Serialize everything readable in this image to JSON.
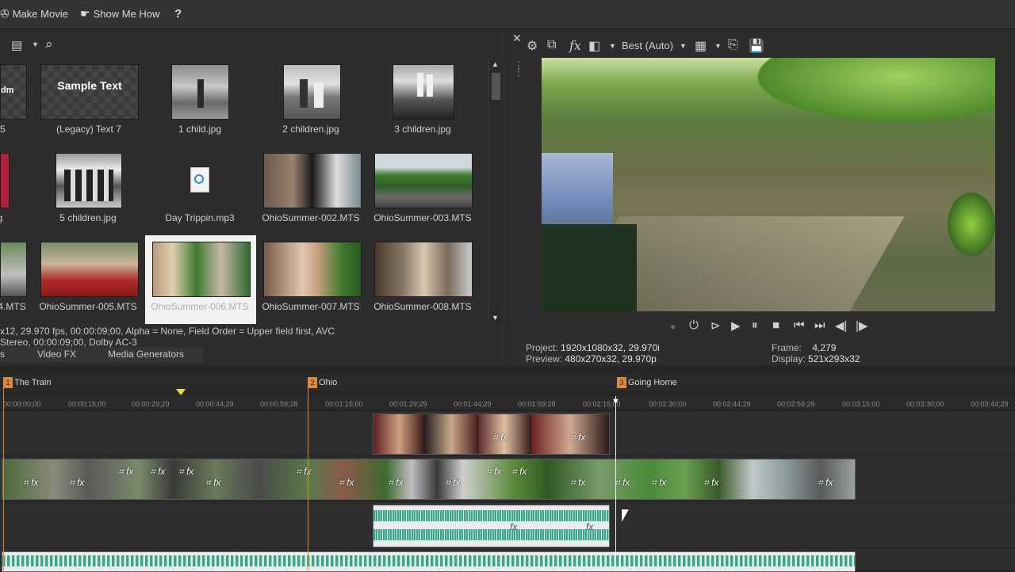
{
  "menubar": {
    "make_movie": "Make Movie",
    "show_me_how": "Show Me How",
    "help": "?"
  },
  "media": {
    "items": [
      {
        "label": "t 5",
        "kind": "checker-partial",
        "thumb_text": "dm"
      },
      {
        "label": "(Legacy) Text 7",
        "kind": "checker",
        "thumb_text": "Sample Text"
      },
      {
        "label": "1 child.jpg",
        "kind": "photo-bw"
      },
      {
        "label": "2 children.jpg",
        "kind": "photo-bw"
      },
      {
        "label": "3 children.jpg",
        "kind": "photo-bw"
      },
      {
        "label": "g",
        "kind": "photo-partial"
      },
      {
        "label": "5 children.jpg",
        "kind": "photo-bw"
      },
      {
        "label": "Day Trippin.mp3",
        "kind": "audio-file"
      },
      {
        "label": "OhioSummer-002.MTS",
        "kind": "video"
      },
      {
        "label": "OhioSummer-003.MTS",
        "kind": "video"
      },
      {
        "label": "4.MTS",
        "kind": "video-partial"
      },
      {
        "label": "OhioSummer-005.MTS",
        "kind": "video"
      },
      {
        "label": "OhioSummer-006.MTS",
        "kind": "video-selected"
      },
      {
        "label": "OhioSummer-007.MTS",
        "kind": "video"
      },
      {
        "label": "OhioSummer-008.MTS",
        "kind": "video"
      }
    ],
    "info_line1": "x12, 29.970 fps, 00:00:09;00, Alpha = None, Field Order = Upper field first, AVC",
    "info_line2": "Stereo, 00:00:09;00, Dolby AC-3",
    "tabs": [
      "s",
      "Video FX",
      "Media Generators"
    ]
  },
  "preview": {
    "quality": "Best (Auto)",
    "project_label": "Project:",
    "project_value": "1920x1080x32, 29.970i",
    "preview_label": "Preview:",
    "preview_value": "480x270x32, 29.970p",
    "frame_label": "Frame:",
    "frame_value": "4,279",
    "display_label": "Display:",
    "display_value": "521x293x32"
  },
  "timeline": {
    "markers": [
      {
        "num": "1",
        "label": "The Train"
      },
      {
        "num": "2",
        "label": "Ohio"
      },
      {
        "num": "3",
        "label": "Going Home"
      }
    ],
    "ruler": [
      "00:00:00;00",
      "00:00:15;00",
      "00:00:29;29",
      "00:00:44;29",
      "00:00:59;28",
      "00:01:15;00",
      "00:01:29;29",
      "00:01:44;29",
      "00:01:59;28",
      "00:02:15;00",
      "00:02:30;00",
      "00:02:44;29",
      "00:02:59;29",
      "00:03:15;00",
      "00:03:30;00",
      "00:03:44;29"
    ]
  },
  "colors": {
    "accent_orange": "#d98a3d",
    "audio_wave": "#3aa58a",
    "panel_bg": "#2d2d2d"
  }
}
